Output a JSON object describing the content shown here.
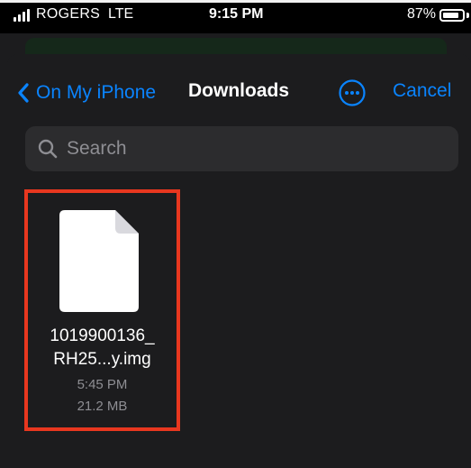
{
  "status_bar": {
    "carrier": "ROGERS",
    "network": "LTE",
    "time": "9:15 PM",
    "battery_percent": "87%",
    "battery_level": 0.87
  },
  "nav": {
    "back_label": "On My iPhone",
    "title": "Downloads",
    "cancel_label": "Cancel"
  },
  "search": {
    "placeholder": "Search"
  },
  "files": [
    {
      "name_line1": "1019900136_",
      "name_line2": "RH25...y.img",
      "time": "5:45 PM",
      "size": "21.2 MB",
      "icon": "document-icon"
    }
  ],
  "colors": {
    "accent": "#0a84ff",
    "highlight": "#e8371f",
    "background": "#1c1c1e"
  }
}
